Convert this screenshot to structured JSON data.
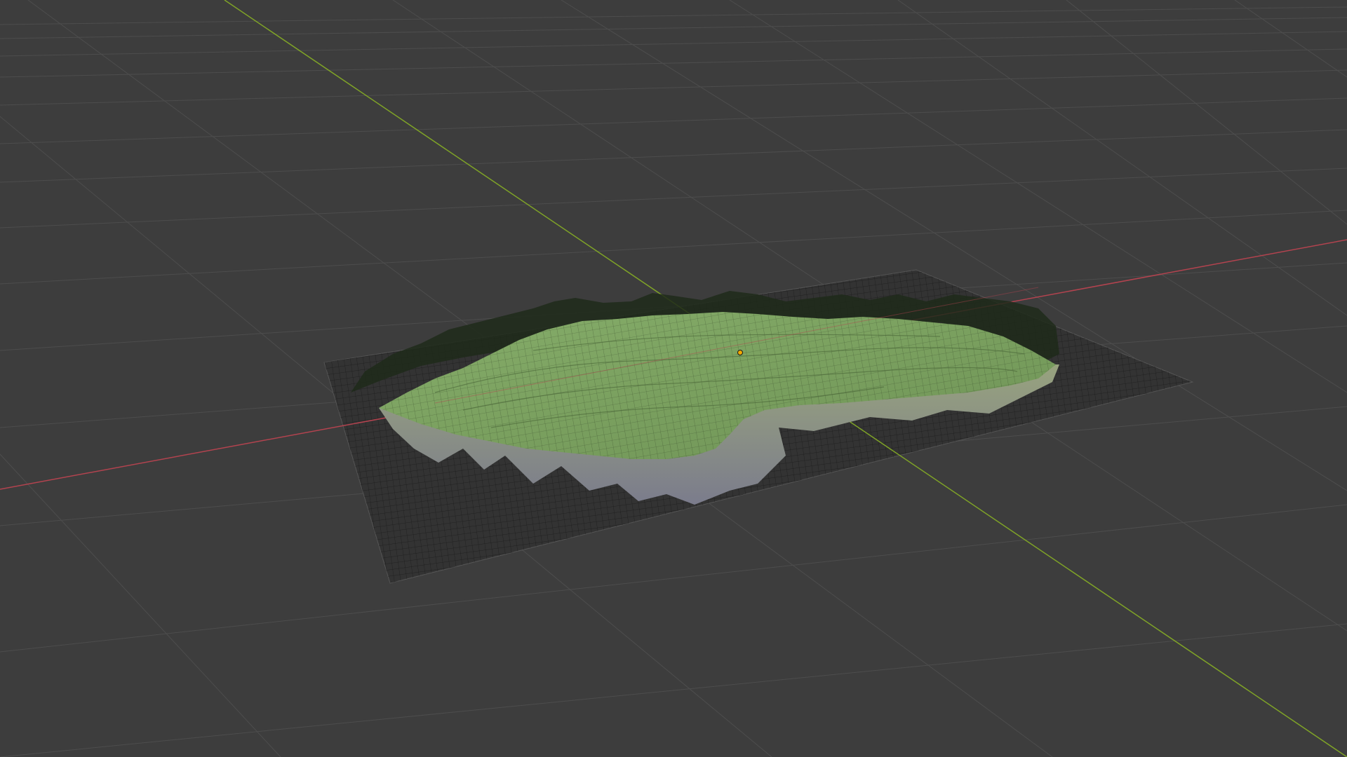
{
  "viewport": {
    "background": "#3d3d3d",
    "grid_color": "#4d4d4d",
    "axis_x_color": "#b3434f",
    "axis_y_color": "#7fa327"
  },
  "scene": {
    "objects": [
      {
        "name": "ground-plane",
        "color": "#2e2e2e",
        "wire_color": "#1f1f1f"
      },
      {
        "name": "terrain-mesh",
        "top_color": "#80a568",
        "side_color": "#8a8a95",
        "wire_color": "#111111"
      }
    ],
    "origin_color": "#f2a900"
  }
}
